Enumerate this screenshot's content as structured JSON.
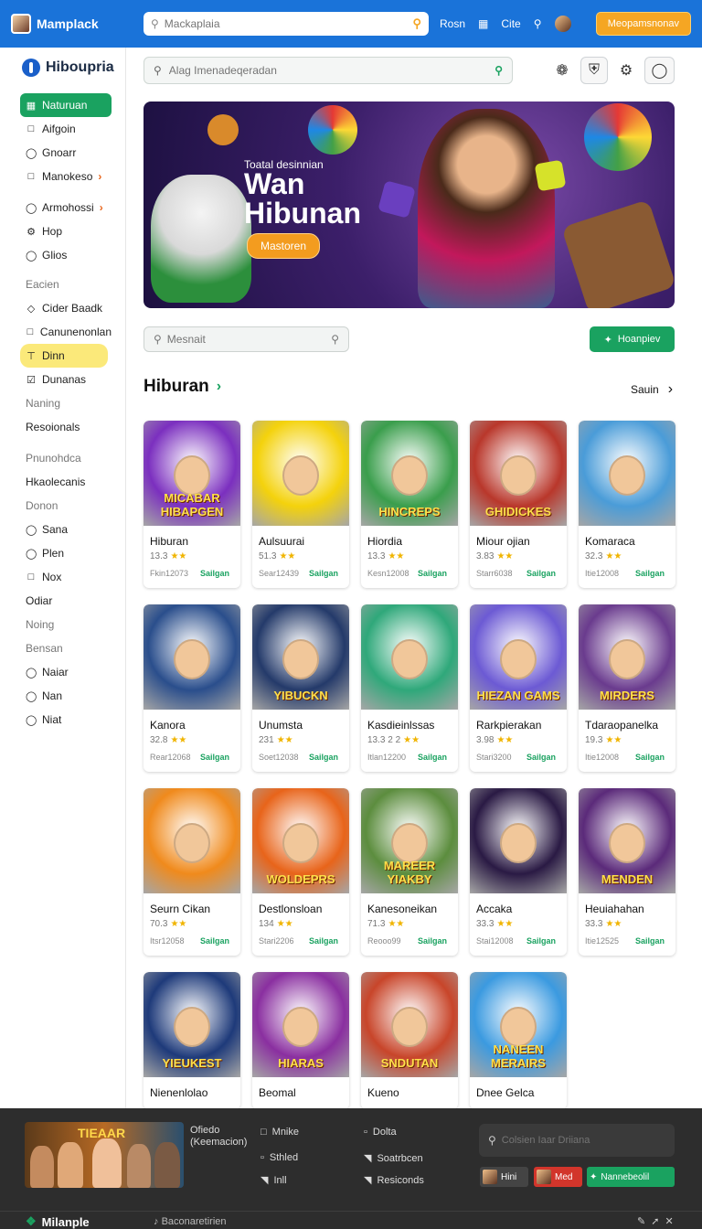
{
  "topbar": {
    "brand": "Mamplack",
    "search_placeholder": "Mackaplaia",
    "links": [
      "Rosn",
      "Cite"
    ],
    "cta": "Meopamsnonav"
  },
  "sidebar": {
    "brand": "Hiboupria",
    "items": [
      {
        "label": "Naturuan",
        "icon": "grid-icon",
        "active": true
      },
      {
        "label": "Aifgoin",
        "icon": "square-icon"
      },
      {
        "label": "Gnoarr",
        "icon": "circle-icon"
      },
      {
        "label": "Manokeso",
        "icon": "square-icon",
        "arrow": true
      },
      {
        "label": "Armohossi",
        "icon": "circle-icon",
        "arrow": true
      },
      {
        "label": "Hop",
        "icon": "gear-icon"
      },
      {
        "label": "Glios",
        "icon": "circle-icon"
      }
    ],
    "section1": "Eacien",
    "items2": [
      {
        "label": "Cider Baadk",
        "icon": "diamond-icon"
      },
      {
        "label": "Canunenonlan",
        "icon": "square-icon"
      },
      {
        "label": "Dinn",
        "icon": "tag-icon",
        "highlight": true
      },
      {
        "label": "Dunanas",
        "icon": "check-icon"
      }
    ],
    "section2": "Naning",
    "items3": [
      "Resoionals"
    ],
    "section3": "Pnunohdca",
    "items4": [
      "Hkaolecanis"
    ],
    "section4": "Donon",
    "items5": [
      {
        "label": "Sana",
        "icon": "circle-icon"
      },
      {
        "label": "Plen",
        "icon": "circle-icon"
      },
      {
        "label": "Nox",
        "icon": "square-icon"
      }
    ],
    "items6": [
      "Odiar"
    ],
    "section5": "Noing",
    "section6": "Bensan",
    "items7": [
      {
        "label": "Naiar",
        "icon": "circle-icon"
      },
      {
        "label": "Nan",
        "icon": "circle-icon"
      },
      {
        "label": "Niat",
        "icon": "circle-icon"
      }
    ]
  },
  "main": {
    "search_placeholder": "Alag Imenadeqeradan",
    "hero": {
      "subtitle": "Toatal desinnian",
      "title_line1": "Wan",
      "title_line2": "Hibunan",
      "button": "Mastoren"
    },
    "filter_placeholder": "Mesnait",
    "green_button": "Hoanpiev",
    "section_title": "Hiburan",
    "see_all": "Sauin"
  },
  "cards": [
    {
      "title": "Hiburan",
      "rating": "13.3",
      "code": "Fkin12073",
      "action": "Sailgan",
      "img_text": "MICABAR HIBAPGEN",
      "bg": "#7b2fbf"
    },
    {
      "title": "Aulsuurai",
      "rating": "51.3",
      "code": "Sear12439",
      "action": "Sailgan",
      "img_text": "",
      "bg": "#f4d20c"
    },
    {
      "title": "Hiordia",
      "rating": "13.3",
      "code": "Kesn12008",
      "action": "Sailgan",
      "img_text": "HINCREPS",
      "bg": "#3a9e4c"
    },
    {
      "title": "Miour ojian",
      "rating": "3.83",
      "code": "Starr6038",
      "action": "Sailgan",
      "img_text": "GHIDICKES",
      "bg": "#b9372b"
    },
    {
      "title": "Komaraca",
      "rating": "32.3",
      "code": "Itie12008",
      "action": "Sailgan",
      "img_text": "",
      "bg": "#4a9cd8"
    },
    {
      "title": "Kanora",
      "rating": "32.8",
      "code": "Rear12068",
      "action": "Sailgan",
      "img_text": "",
      "bg": "#2a4e8c"
    },
    {
      "title": "Unumsta",
      "rating": "231",
      "code": "Soet12038",
      "action": "Sailgan",
      "img_text": "YIBUCKN",
      "bg": "#243a6a"
    },
    {
      "title": "Kasdieinlssas",
      "rating": "13.3 2 2",
      "code": "Itlan12200",
      "action": "Sailgan",
      "img_text": "",
      "bg": "#2fa87a"
    },
    {
      "title": "Rarkpierakan",
      "rating": "3.98",
      "code": "Stari3200",
      "action": "Sailgan",
      "img_text": "HIEZAN GAMS",
      "bg": "#6c5ad4"
    },
    {
      "title": "Tdaraopanelka",
      "rating": "19.3",
      "code": "Itie12008",
      "action": "Sailgan",
      "img_text": "MIRDERS",
      "bg": "#6a3b8e"
    },
    {
      "title": "Seurn Cikan",
      "rating": "70.3",
      "code": "Itsr12058",
      "action": "Sailgan",
      "img_text": "",
      "bg": "#f08a1c"
    },
    {
      "title": "Destlonsloan",
      "rating": "134",
      "code": "Stari2206",
      "action": "Sailgan",
      "img_text": "WOLDEPRS",
      "bg": "#e8641a"
    },
    {
      "title": "Kanesoneikan",
      "rating": "71.3",
      "code": "Reooo99",
      "action": "Sailgan",
      "img_text": "MAREER YIAKBY",
      "bg": "#5c8d3e"
    },
    {
      "title": "Accaka",
      "rating": "33.3",
      "code": "Stai12008",
      "action": "Sailgan",
      "img_text": "",
      "bg": "#2a1a44"
    },
    {
      "title": "Heuiahahan",
      "rating": "33.3",
      "code": "Itie12525",
      "action": "Sailgan",
      "img_text": "MENDEN",
      "bg": "#5b2a7a"
    },
    {
      "title": "Nienenlolao",
      "rating": "",
      "code": "",
      "action": "",
      "img_text": "YIEUKEST",
      "bg": "#1e3a7a"
    },
    {
      "title": "Beomal",
      "rating": "",
      "code": "",
      "action": "",
      "img_text": "HIARAS",
      "bg": "#8a2fa0"
    },
    {
      "title": "Kueno",
      "rating": "",
      "code": "",
      "action": "",
      "img_text": "SNDUTAN",
      "bg": "#c8452a"
    },
    {
      "title": "Dnee Gelca",
      "rating": "",
      "code": "",
      "action": "",
      "img_text": "NANEEN MERAIRS",
      "bg": "#3b9ae0"
    }
  ],
  "footer": {
    "image_text": "TIEAAR",
    "caption_line1": "Ofiedo",
    "caption_line2": "(Keemacion)",
    "links_col1": [
      {
        "label": "Mnike",
        "icon": "square-icon"
      },
      {
        "label": "Sthled",
        "icon": "chat-icon"
      },
      {
        "label": "Inll",
        "icon": "doc-icon"
      }
    ],
    "links_col2": [
      {
        "label": "Dolta",
        "icon": "chat-icon"
      },
      {
        "label": "Soatrbcen",
        "icon": "doc-icon"
      },
      {
        "label": "Resiconds",
        "icon": "doc-icon"
      }
    ],
    "search_placeholder": "Colsien Iaar Driiana",
    "chips": [
      {
        "label": "Hini",
        "bg": "#444"
      },
      {
        "label": "Med",
        "bg": "#d2352b"
      },
      {
        "label": "Nannebeolil",
        "bg": "#1aa260"
      }
    ],
    "bottom_brand": "Milanple",
    "bottom_middle": "Baconaretirien"
  }
}
